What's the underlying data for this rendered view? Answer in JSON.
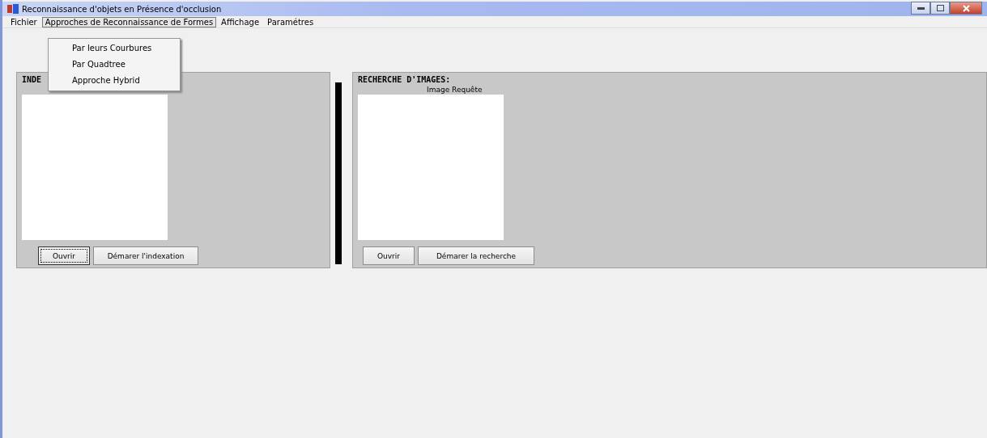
{
  "window": {
    "title": "Reconnaissance d'objets en Présence  d'occlusion"
  },
  "menu": [
    {
      "label": "Fichier",
      "selected": false
    },
    {
      "label": "Approches de Reconnaissance de Formes",
      "selected": true
    },
    {
      "label": "Affichage",
      "selected": false
    },
    {
      "label": "Paramétres",
      "selected": false
    }
  ],
  "dropdown": {
    "items": [
      "Par leurs Courbures",
      "Par Quadtree",
      "Approche Hybrid"
    ]
  },
  "panels": [
    {
      "title": "INDE",
      "buttons": [
        {
          "label": "Ouvrir",
          "focused": true
        },
        {
          "label": "Démarer l'indexation",
          "focused": false
        }
      ]
    },
    {
      "title": "RECHERCHE D'IMAGES:",
      "caption": "Image Requête",
      "buttons": [
        {
          "label": "Ouvrir",
          "focused": false
        },
        {
          "label": "Démarer la recherche",
          "focused": false
        }
      ]
    }
  ]
}
